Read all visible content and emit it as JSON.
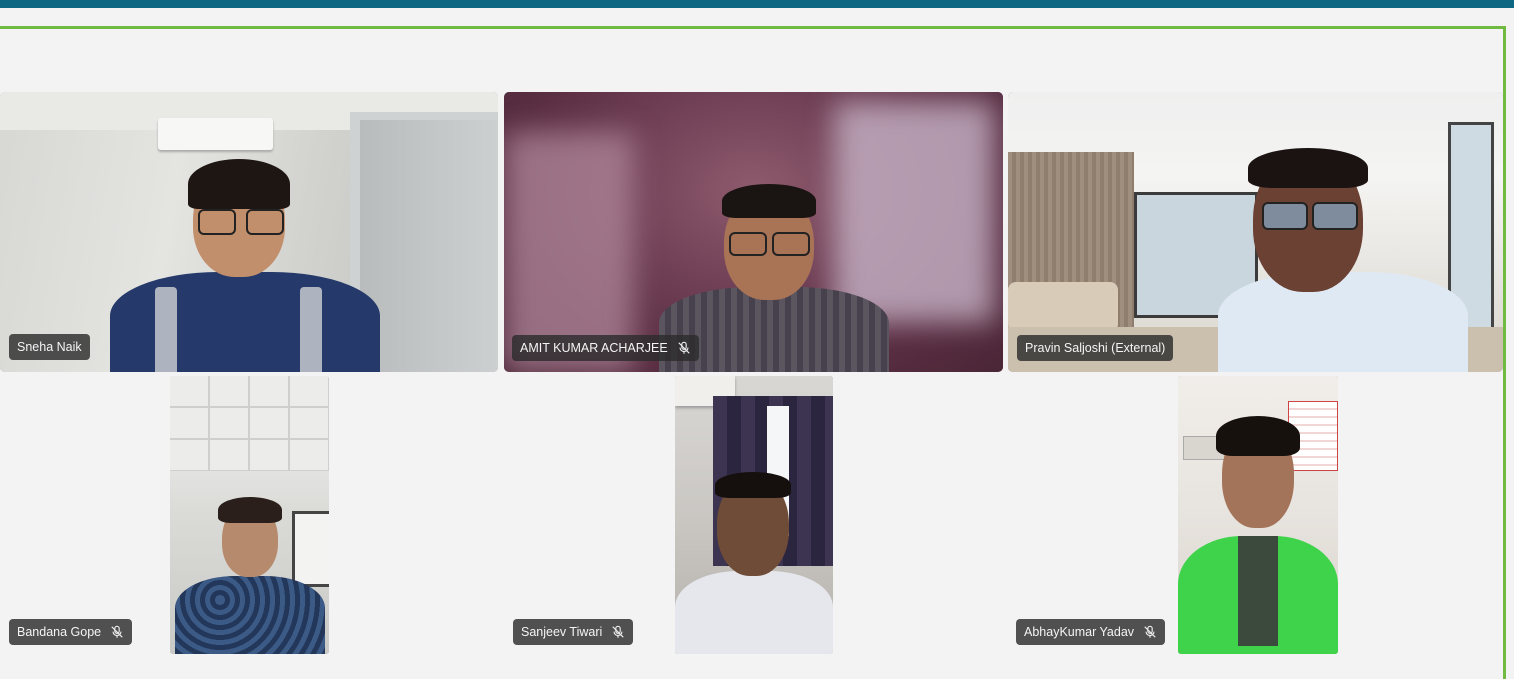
{
  "participants": [
    {
      "name": "Sneha Naik",
      "muted": false
    },
    {
      "name": "AMIT KUMAR ACHARJEE",
      "muted": true
    },
    {
      "name": "Pravin Saljoshi (External)",
      "muted": false
    },
    {
      "name": "Bandana Gope",
      "muted": true
    },
    {
      "name": "Sanjeev Tiwari",
      "muted": true
    },
    {
      "name": "AbhayKumar Yadav",
      "muted": true
    }
  ],
  "icons": {
    "muted": "mic-off-icon"
  },
  "colors": {
    "top_bar": "#0e6782",
    "frame_border": "#6fba3f",
    "stage_bg": "#f3f3f3",
    "name_tag_bg": "#2c2c2c"
  }
}
